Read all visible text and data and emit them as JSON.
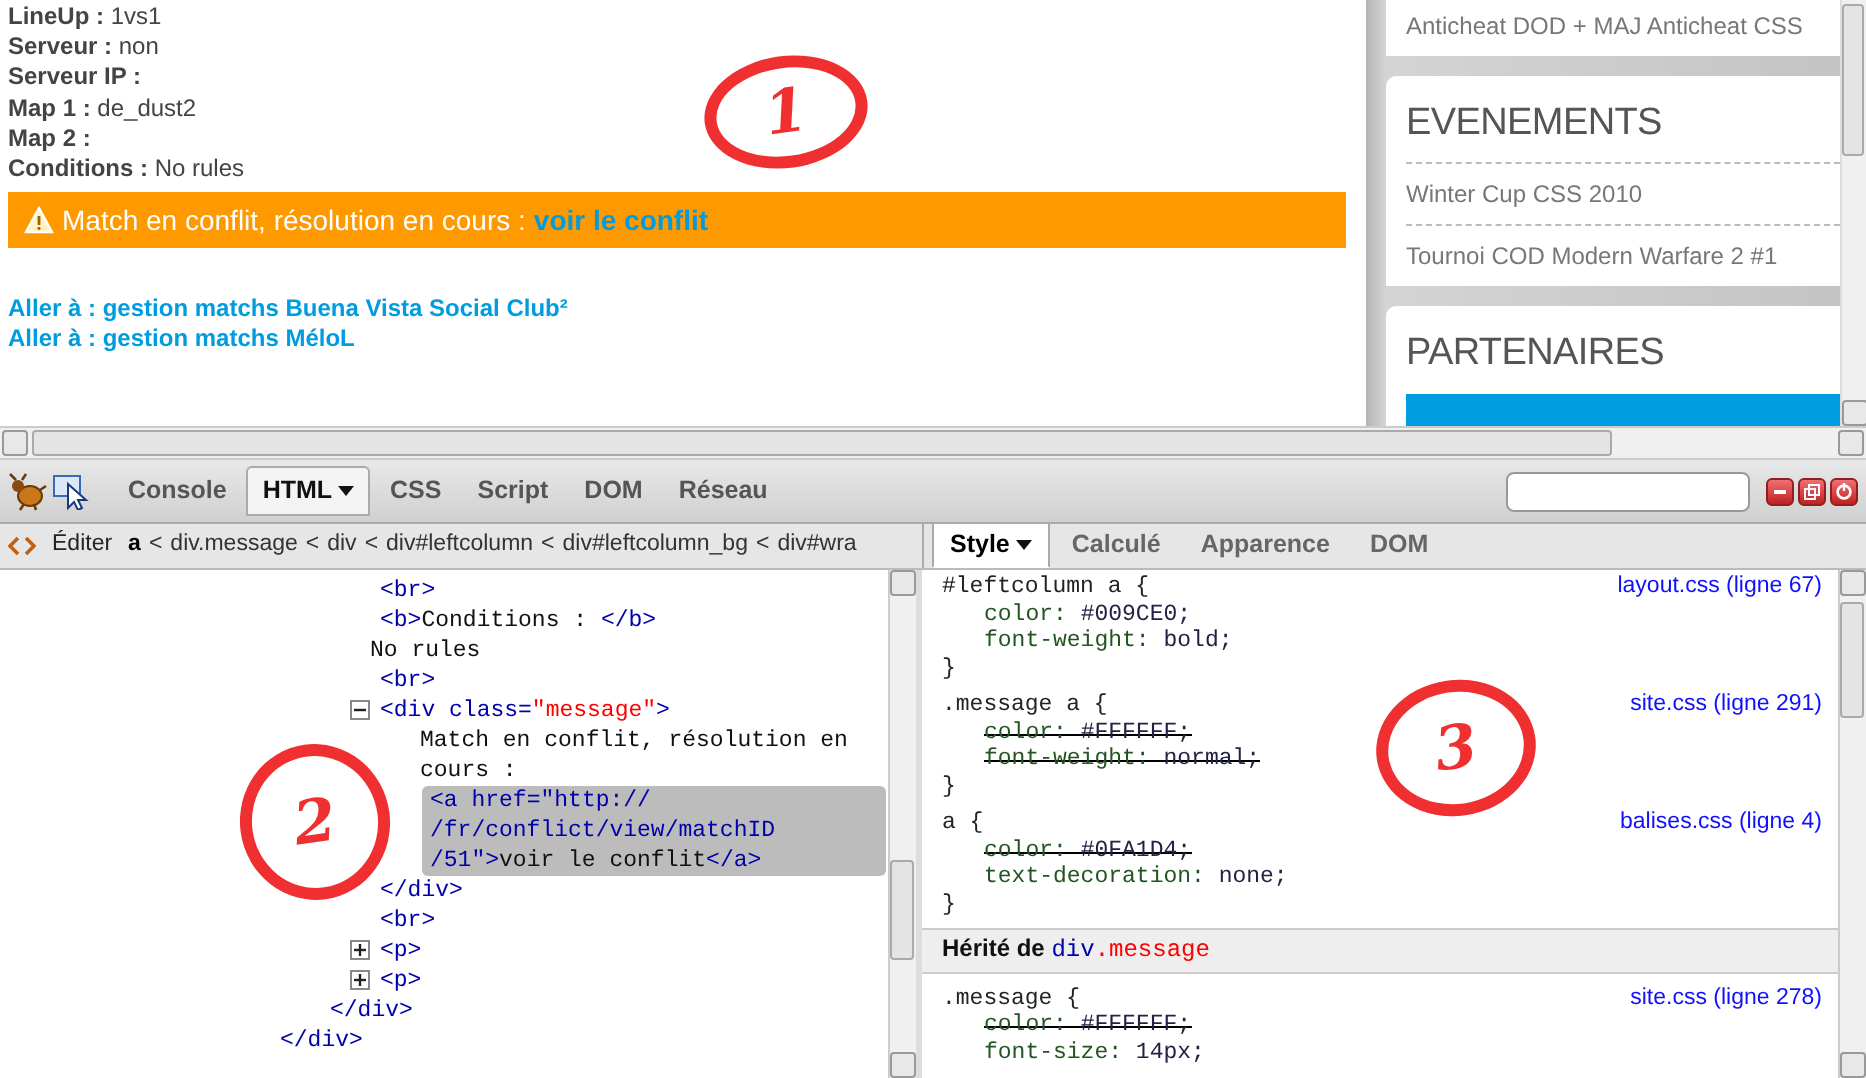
{
  "page": {
    "fields": [
      {
        "label": "LineUp :",
        "value": "1vs1"
      },
      {
        "label": "Serveur :",
        "value": "non"
      },
      {
        "label": "Serveur IP :"
      },
      {
        "label": "Map 1 :",
        "value": "de_dust2"
      },
      {
        "label": "Map 2 :"
      },
      {
        "label": "Conditions :",
        "value": "No rules"
      }
    ],
    "message": {
      "text": "Match en conflit, résolution en cours :",
      "link": "voir le conflit"
    },
    "links": [
      "Aller à : gestion matchs Buena Vista Social Club²",
      "Aller à : gestion matchs MéloL"
    ]
  },
  "sidebar": {
    "top_item": "Anticheat DOD + MAJ Anticheat CSS",
    "sections": [
      {
        "title": "EVENEMENTS",
        "items": [
          "Winter Cup CSS 2010",
          "Tournoi COD Modern Warfare 2 #1"
        ]
      },
      {
        "title": "PARTENAIRES",
        "banner": true
      }
    ]
  },
  "devtools": {
    "tabs": [
      {
        "label": "Console",
        "selected": false
      },
      {
        "label": "HTML",
        "selected": true,
        "dropdown": true
      },
      {
        "label": "CSS",
        "selected": false
      },
      {
        "label": "Script",
        "selected": false
      },
      {
        "label": "DOM",
        "selected": false
      },
      {
        "label": "Réseau",
        "selected": false
      }
    ],
    "edit_label": "Éditer",
    "breadcrumb": [
      {
        "label": "a",
        "separator": "<",
        "selected": true
      },
      {
        "label": "div.message",
        "separator": "<",
        "selected": false
      },
      {
        "label": "div",
        "separator": "<",
        "selected": false
      },
      {
        "label": "div#leftcolumn",
        "separator": "<",
        "selected": false
      },
      {
        "label": "div#leftcolumn_bg",
        "separator": "<",
        "selected": false
      },
      {
        "label": "div#wra",
        "selected": false
      }
    ],
    "tree": [
      {
        "selected": false,
        "close": [
          {
            "kind": "tag",
            "text": "</div>"
          }
        ],
        "children": [
          {
            "selected": false,
            "close": [
              {
                "kind": "tag",
                "text": "</div>"
              }
            ],
            "children": [
              {
                "selected": false,
                "line": [
                  {
                    "kind": "tag",
                    "text": "<br>"
                  }
                ]
              },
              {
                "selected": false,
                "line": [
                  {
                    "kind": "tag",
                    "text": "<b>"
                  },
                  {
                    "kind": "text",
                    "text": "Conditions : "
                  },
                  {
                    "kind": "tag",
                    "text": "</b>"
                  }
                ]
              },
              {
                "selected": false,
                "line": [
                  {
                    "kind": "text",
                    "text": "No rules"
                  }
                ]
              },
              {
                "selected": false,
                "line": [
                  {
                    "kind": "tag",
                    "text": "<br>"
                  }
                ]
              },
              {
                "selected": false,
                "expanded": true,
                "line": [
                  {
                    "kind": "tag",
                    "text": "<div"
                  },
                  {
                    "kind": "attr",
                    "text": " class="
                  },
                  {
                    "kind": "value",
                    "text": "\"message\""
                  },
                  {
                    "kind": "tag",
                    "text": ">"
                  }
                ],
                "close": [
                  {
                    "kind": "tag",
                    "text": "</div>"
                  }
                ],
                "children": [
                  {
                    "selected": false,
                    "line": [
                      {
                        "kind": "text",
                        "text": "Match en conflit, résolution en cours :"
                      }
                    ]
                  },
                  {
                    "selected": true,
                    "line": [
                      {
                        "kind": "tag",
                        "text": "<a"
                      },
                      {
                        "kind": "attr",
                        "text": " href="
                      },
                      {
                        "kind": "attr",
                        "text": "\"http:// /fr/conflict/view/matchID /51\""
                      },
                      {
                        "kind": "tag",
                        "text": ">"
                      },
                      {
                        "kind": "text",
                        "text": "voir le conflit"
                      },
                      {
                        "kind": "tag",
                        "text": "</a>"
                      }
                    ]
                  }
                ]
              },
              {
                "selected": false,
                "line": [
                  {
                    "kind": "tag",
                    "text": "<br>"
                  }
                ]
              },
              {
                "selected": false,
                "expanded": false,
                "line": [
                  {
                    "kind": "tag",
                    "text": "<p>"
                  }
                ]
              },
              {
                "selected": false,
                "expanded": false,
                "line": [
                  {
                    "kind": "tag",
                    "text": "<p>"
                  }
                ]
              }
            ]
          }
        ]
      }
    ],
    "side_tabs": [
      {
        "label": "Style",
        "selected": true,
        "dropdown": true
      },
      {
        "label": "Calculé",
        "selected": false
      },
      {
        "label": "Apparence",
        "selected": false
      },
      {
        "label": "DOM",
        "selected": false
      }
    ],
    "rules": [
      {
        "open": "#leftcolumn a {",
        "source": "layout.css (ligne 67)",
        "close": "}",
        "declarations": [
          {
            "property": "color:",
            "value": "#009CE0;",
            "overridden": false
          },
          {
            "property": "font-weight:",
            "value": "bold;",
            "overridden": false
          }
        ]
      },
      {
        "open": ".message a {",
        "source": "site.css (ligne 291)",
        "close": "}",
        "declarations": [
          {
            "property": "color:",
            "value": "#FFFFFF;",
            "overridden": true
          },
          {
            "property": "font-weight:",
            "value": "normal;",
            "overridden": true
          }
        ]
      },
      {
        "open": "a {",
        "source": "balises.css (ligne 4)",
        "close": "}",
        "declarations": [
          {
            "property": "color:",
            "value": "#0FA1D4;",
            "overridden": true
          },
          {
            "property": "text-decoration:",
            "value": "none;",
            "overridden": false
          }
        ]
      }
    ],
    "inherited": {
      "label": "Hérité de",
      "element": [
        {
          "kind": "tag",
          "text": "div"
        },
        {
          "kind": "value",
          "text": ".message"
        }
      ]
    },
    "inherited_rules": [
      {
        "open": ".message {",
        "source": "site.css (ligne 278)",
        "declarations": [
          {
            "property": "color:",
            "value": "#FFFFFF;",
            "overridden": true
          },
          {
            "property": "font-size:",
            "value": "14px;",
            "overridden": false
          }
        ]
      }
    ]
  },
  "annotations": [
    {
      "label": "1"
    },
    {
      "label": "2"
    },
    {
      "label": "3"
    }
  ]
}
